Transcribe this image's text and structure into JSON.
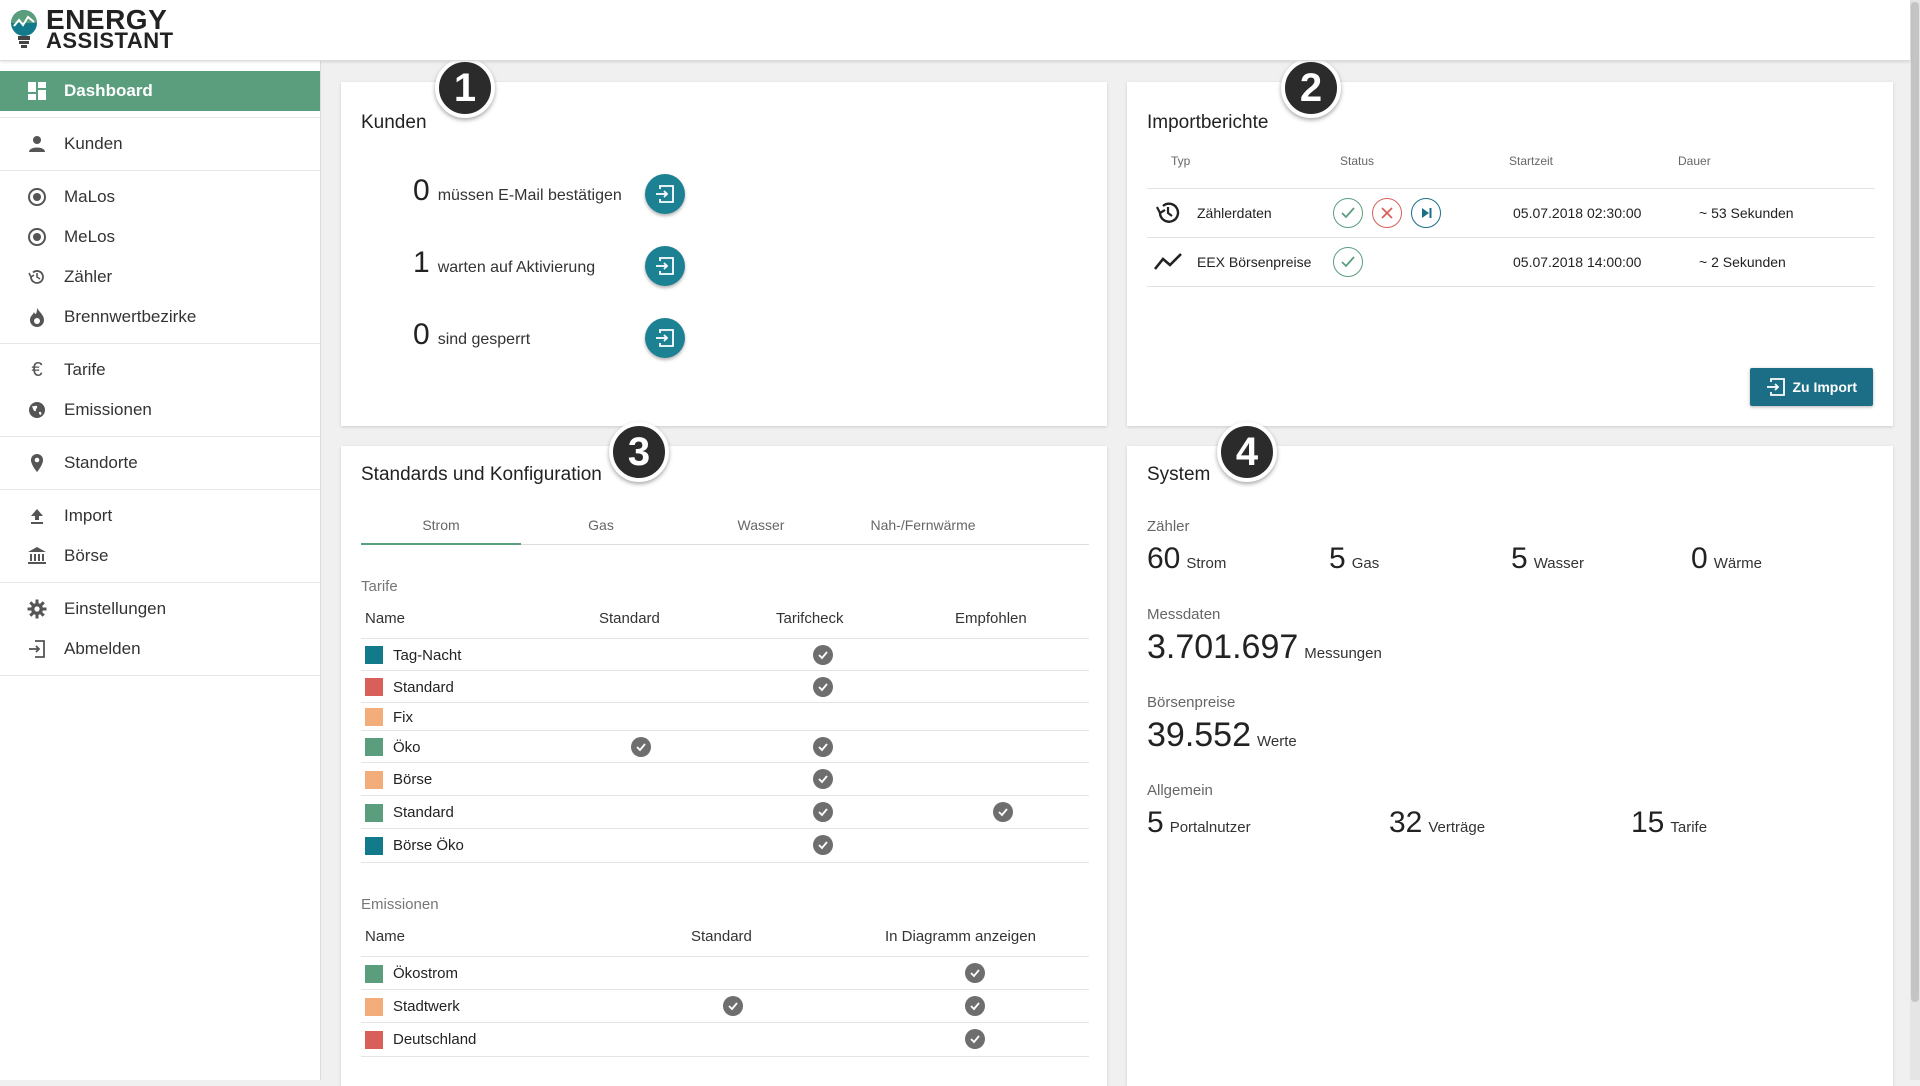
{
  "app": {
    "logo_line1": "ENERGY",
    "logo_line2": "ASSISTANT"
  },
  "sidebar": {
    "items": [
      {
        "label": "Dashboard",
        "icon": "dashboard-icon",
        "active": true
      },
      {
        "label": "Kunden",
        "icon": "person-icon"
      },
      {
        "label": "MaLos",
        "icon": "radio-icon"
      },
      {
        "label": "MeLos",
        "icon": "radio-icon"
      },
      {
        "label": "Zähler",
        "icon": "history-icon"
      },
      {
        "label": "Brennwertbezirke",
        "icon": "flame-icon"
      },
      {
        "label": "Tarife",
        "icon": "euro-icon"
      },
      {
        "label": "Emissionen",
        "icon": "globe-icon"
      },
      {
        "label": "Standorte",
        "icon": "location-pin-icon"
      },
      {
        "label": "Import",
        "icon": "upload-icon"
      },
      {
        "label": "Börse",
        "icon": "bank-icon"
      },
      {
        "label": "Einstellungen",
        "icon": "gear-icon"
      },
      {
        "label": "Abmelden",
        "icon": "logout-icon"
      }
    ]
  },
  "badges": [
    "1",
    "2",
    "3",
    "4"
  ],
  "kunden": {
    "title": "Kunden",
    "rows": [
      {
        "count": "0",
        "label": "müssen E-Mail bestätigen"
      },
      {
        "count": "1",
        "label": "warten auf Aktivierung"
      },
      {
        "count": "0",
        "label": "sind gesperrt"
      }
    ]
  },
  "import": {
    "title": "Importberichte",
    "headers": {
      "typ": "Typ",
      "status": "Status",
      "start": "Startzeit",
      "dauer": "Dauer"
    },
    "rows": [
      {
        "icon": "history-icon",
        "typ": "Zählerdaten",
        "status": [
          "success",
          "error",
          "skip"
        ],
        "start": "05.07.2018 02:30:00",
        "dauer": "~ 53 Sekunden"
      },
      {
        "icon": "trend-line-icon",
        "typ": "EEX Börsenpreise",
        "status": [
          "success"
        ],
        "start": "05.07.2018 14:00:00",
        "dauer": "~ 2 Sekunden"
      }
    ],
    "button": "Zu Import"
  },
  "standards": {
    "title": "Standards und Konfiguration",
    "tabs": [
      "Strom",
      "Gas",
      "Wasser",
      "Nah-/Fernwärme"
    ],
    "active_tab": 0,
    "tarife_label": "Tarife",
    "tarife_headers": {
      "name": "Name",
      "standard": "Standard",
      "tarifcheck": "Tarifcheck",
      "empfohlen": "Empfohlen"
    },
    "tarife": [
      {
        "name": "Tag-Nacht",
        "color": "#137a8c",
        "standard": false,
        "tarifcheck": true,
        "empfohlen": false
      },
      {
        "name": "Standard",
        "color": "#d9605a",
        "standard": false,
        "tarifcheck": true,
        "empfohlen": false
      },
      {
        "name": "Fix",
        "color": "#f2ad7a",
        "standard": false,
        "tarifcheck": false,
        "empfohlen": false
      },
      {
        "name": "Öko",
        "color": "#5a9e7e",
        "standard": true,
        "tarifcheck": true,
        "empfohlen": false
      },
      {
        "name": "Börse",
        "color": "#f2ad7a",
        "standard": false,
        "tarifcheck": true,
        "empfohlen": false
      },
      {
        "name": "Standard",
        "color": "#5a9e7e",
        "standard": false,
        "tarifcheck": true,
        "empfohlen": true
      },
      {
        "name": "Börse Öko",
        "color": "#137a8c",
        "standard": false,
        "tarifcheck": true,
        "empfohlen": false
      }
    ],
    "emissionen_label": "Emissionen",
    "emissionen_headers": {
      "name": "Name",
      "standard": "Standard",
      "diagramm": "In Diagramm anzeigen"
    },
    "emissionen": [
      {
        "name": "Ökostrom",
        "color": "#5a9e7e",
        "standard": false,
        "diagramm": true
      },
      {
        "name": "Stadtwerk",
        "color": "#f2ad7a",
        "standard": true,
        "diagramm": true
      },
      {
        "name": "Deutschland",
        "color": "#d9605a",
        "standard": false,
        "diagramm": true
      }
    ]
  },
  "system": {
    "title": "System",
    "zaehler_label": "Zähler",
    "zaehler": [
      {
        "n": "60",
        "u": "Strom"
      },
      {
        "n": "5",
        "u": "Gas"
      },
      {
        "n": "5",
        "u": "Wasser"
      },
      {
        "n": "0",
        "u": "Wärme"
      }
    ],
    "messdaten_label": "Messdaten",
    "messdaten": {
      "n": "3.701.697",
      "u": "Messungen"
    },
    "boerse_label": "Börsenpreise",
    "boerse": {
      "n": "39.552",
      "u": "Werte"
    },
    "allgemein_label": "Allgemein",
    "allgemein": [
      {
        "n": "5",
        "u": "Portalnutzer"
      },
      {
        "n": "32",
        "u": "Verträge"
      },
      {
        "n": "15",
        "u": "Tarife"
      }
    ]
  }
}
